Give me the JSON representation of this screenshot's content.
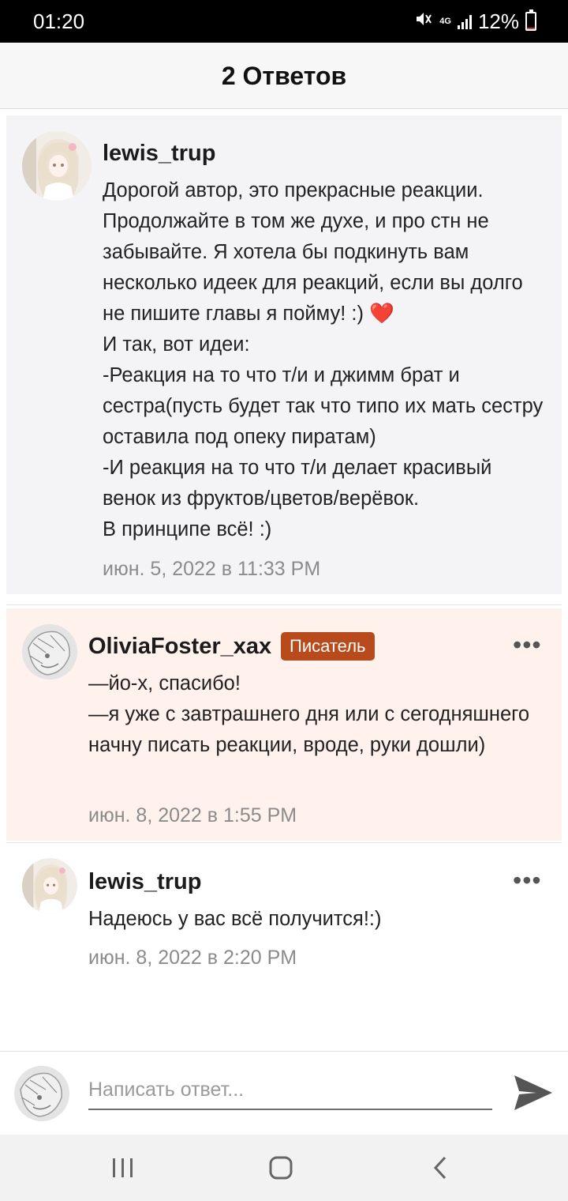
{
  "status_bar": {
    "time": "01:20",
    "network": "4G",
    "battery": "12%",
    "battery_level": 0.12,
    "battery_color": "#e53b2c"
  },
  "header": {
    "title": "2 Ответов"
  },
  "comments": [
    {
      "author": "lewis_trup",
      "text": "Дорогой автор, это прекрасные реакции. Продолжайте в том же духе, и про стн не забывайте. Я хотела бы подкинуть вам несколько идеек для реакций, если вы долго не пишите главы я пойму! :) ❤️\nИ так, вот идеи:\n-Реакция на то что т/и  и джимм брат и сестра(пусть будет так что типо их мать сестру оставила под опеку пиратам)\n-И реакция на то что т/и делает красивый венок из фруктов/цветов/верёвок.\nВ принципе всё! :)",
      "time": "июн. 5, 2022 в 11:33 PM",
      "avatar_icon": "anime-girl-avatar"
    },
    {
      "author": "OliviaFoster_xax",
      "badge": "Писатель",
      "badge_color": "#b84a1c",
      "text": "—йо-х, спасибо!\n—я уже с завтрашнего дня или с сегодняшнего начну писать реакции, вроде, руки дошли)",
      "time": "июн. 8, 2022 в 1:55 PM",
      "avatar_icon": "sketch-avatar",
      "background": "#fff1ec"
    },
    {
      "author": "lewis_trup",
      "text": "Надеюсь у вас всё получится!:)",
      "time": "июн. 8, 2022 в 2:20 PM",
      "avatar_icon": "anime-girl-avatar"
    }
  ],
  "more_icon": "more-dots-icon",
  "compose": {
    "placeholder": "Написать ответ...",
    "value": "",
    "send_icon": "send-icon"
  },
  "navbar": {
    "recent_icon": "recent-apps-icon",
    "home_icon": "home-icon",
    "back_icon": "back-icon"
  }
}
